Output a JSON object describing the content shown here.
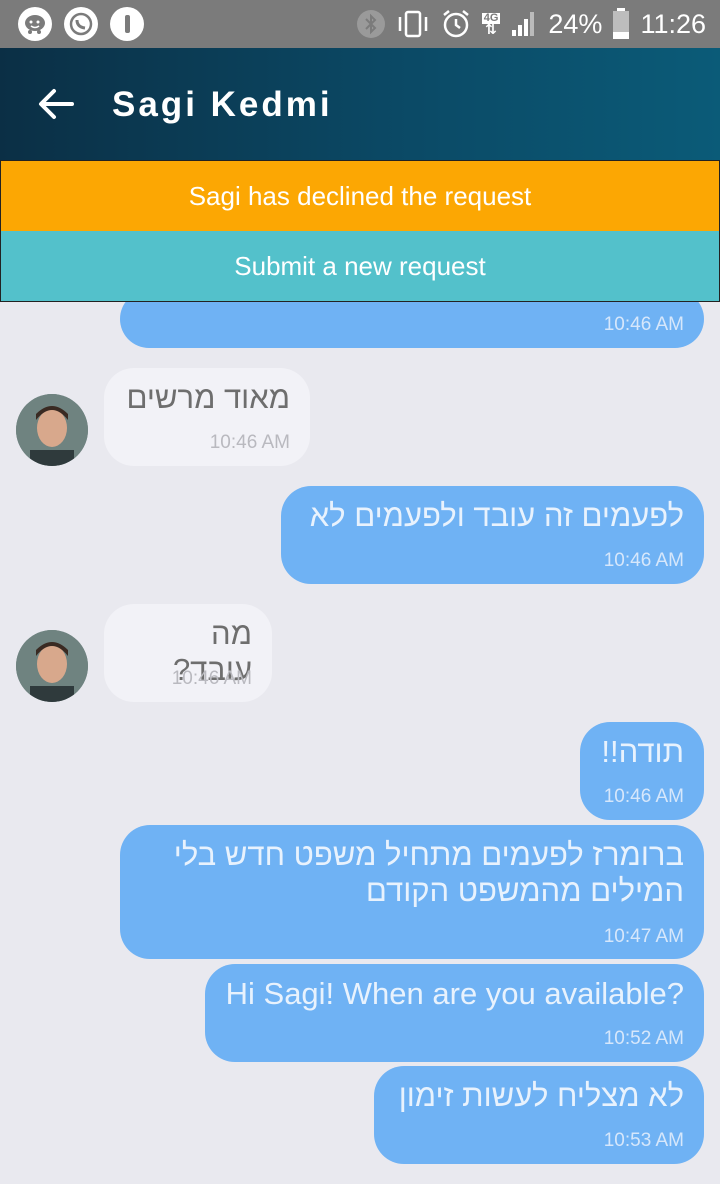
{
  "status_bar": {
    "battery": "24%",
    "time": "11:26",
    "network": "4G"
  },
  "header": {
    "title": "Sagi Kedmi"
  },
  "banners": {
    "declined": "Sagi has declined the request",
    "new_request": "Submit a new request"
  },
  "messages": [
    {
      "dir": "out",
      "text": "",
      "time": "10:46 AM"
    },
    {
      "dir": "in",
      "text": "מאוד מרשים",
      "time": "10:46 AM"
    },
    {
      "dir": "out",
      "text": "לפעמים זה עובד ולפעמים לא",
      "time": "10:46 AM"
    },
    {
      "dir": "in",
      "text": "מה עובד?",
      "time": "10:46 AM"
    },
    {
      "dir": "out",
      "text": "תודה!!",
      "time": "10:46 AM"
    },
    {
      "dir": "out",
      "text": "ברומרז לפעמים מתחיל משפט חדש בלי המילים מהמשפט הקודם",
      "time": "10:47 AM"
    },
    {
      "dir": "out",
      "text": "Hi Sagi! When are you available?",
      "time": "10:52 AM"
    },
    {
      "dir": "out",
      "text": "לא מצליח לעשות זימון",
      "time": "10:53 AM"
    }
  ],
  "colors": {
    "accent_orange": "#fca703",
    "accent_teal": "#53c1cb",
    "outgoing_bubble": "#6fb2f4",
    "incoming_bubble": "#f2f2f7"
  }
}
